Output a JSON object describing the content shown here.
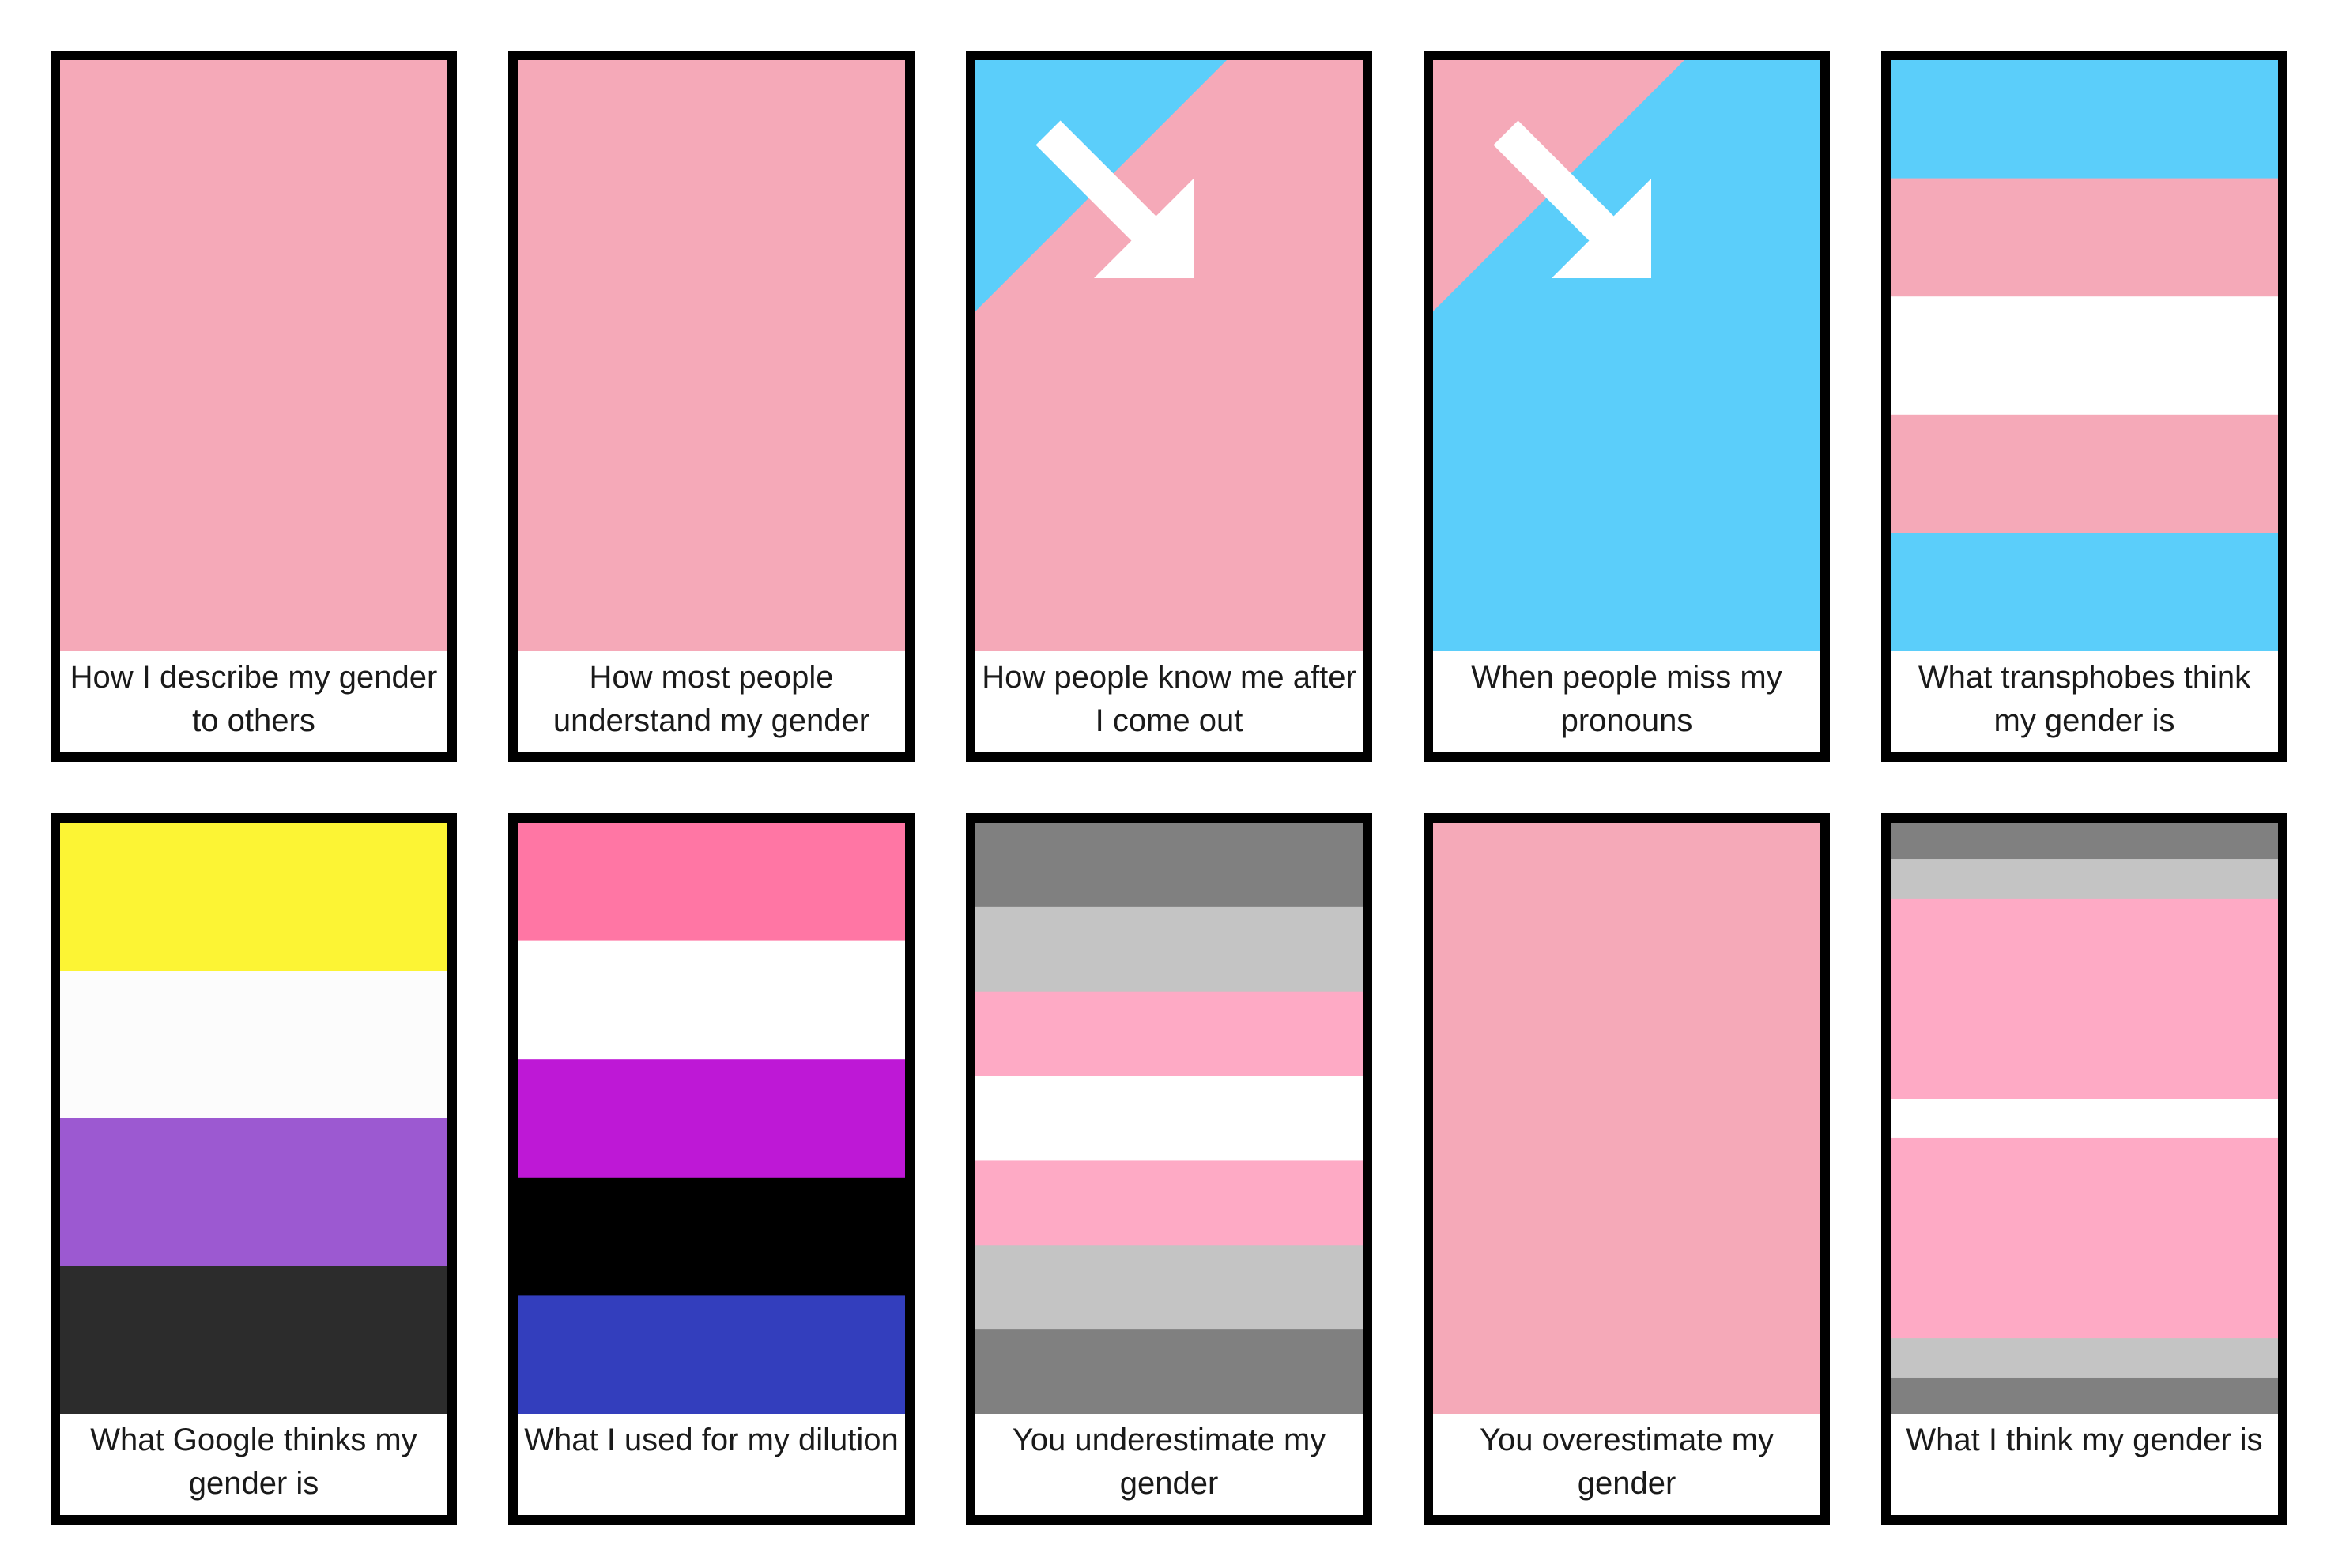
{
  "colors": {
    "pink": "#F5A9B8",
    "blue": "#5BCEFA",
    "white": "#FFFFFF",
    "light_pink": "#FEAAC5",
    "gray": "#808080",
    "light_gray": "#C4C4C4",
    "yellow": "#FCF434",
    "near_white": "#FCFCFC",
    "purple": "#9C59D1",
    "charcoal": "#2C2C2C",
    "hot_pink": "#FF76A4",
    "magenta": "#BE18D6",
    "black": "#000000",
    "indigo": "#333EBD",
    "border": "#000000"
  },
  "cards": [
    {
      "caption": "How I describe my gender to others",
      "flag": {
        "type": "solid",
        "colors": [
          "#F5A9B8"
        ]
      }
    },
    {
      "caption": "How most people understand my gender",
      "flag": {
        "type": "solid",
        "colors": [
          "#F5A9B8"
        ]
      }
    },
    {
      "caption": "How people know me after I come out",
      "flag": {
        "type": "diagonal",
        "corner_color": "#5BCEFA",
        "base_color": "#F5A9B8",
        "icon": "arrow-down-right-icon"
      }
    },
    {
      "caption": "When people miss my pronouns",
      "flag": {
        "type": "diagonal",
        "corner_color": "#F5A9B8",
        "base_color": "#5BCEFA",
        "icon": "arrow-down-right-icon"
      }
    },
    {
      "caption": "What transphobes think my gender is",
      "flag": {
        "type": "stripes",
        "name": "transgender",
        "colors": [
          "#5BCEFA",
          "#F5A9B8",
          "#FFFFFF",
          "#F5A9B8",
          "#5BCEFA"
        ],
        "weights": [
          1,
          1,
          1,
          1,
          1
        ]
      }
    },
    {
      "caption": "What Google thinks my gender is",
      "flag": {
        "type": "stripes",
        "name": "nonbinary",
        "colors": [
          "#FCF434",
          "#FCFCFC",
          "#9C59D1",
          "#2C2C2C"
        ],
        "weights": [
          1,
          1,
          1,
          1
        ]
      }
    },
    {
      "caption": "What I used for my dilution",
      "flag": {
        "type": "stripes",
        "name": "genderfluid",
        "colors": [
          "#FF76A4",
          "#FFFFFF",
          "#BE18D6",
          "#000000",
          "#333EBD"
        ],
        "weights": [
          1,
          1,
          1,
          1,
          1
        ]
      }
    },
    {
      "caption": "You underestimate my gender",
      "flag": {
        "type": "stripes",
        "name": "demigirl",
        "colors": [
          "#808080",
          "#C4C4C4",
          "#FEAAC5",
          "#FFFFFF",
          "#FEAAC5",
          "#C4C4C4",
          "#808080"
        ],
        "weights": [
          1,
          1,
          1,
          1,
          1,
          1,
          1
        ]
      }
    },
    {
      "caption": "You overestimate my gender",
      "flag": {
        "type": "solid",
        "colors": [
          "#F5A9B8"
        ]
      }
    },
    {
      "caption": "What I think my gender is",
      "flag": {
        "type": "stripes",
        "name": "thin-demigirl",
        "colors": [
          "#808080",
          "#C4C4C4",
          "#FEAAC5",
          "#FFFFFF",
          "#FEAAC5",
          "#C4C4C4",
          "#808080"
        ],
        "weights": [
          0.6,
          0.65,
          3.3,
          0.65,
          3.3,
          0.65,
          0.6
        ]
      }
    }
  ]
}
